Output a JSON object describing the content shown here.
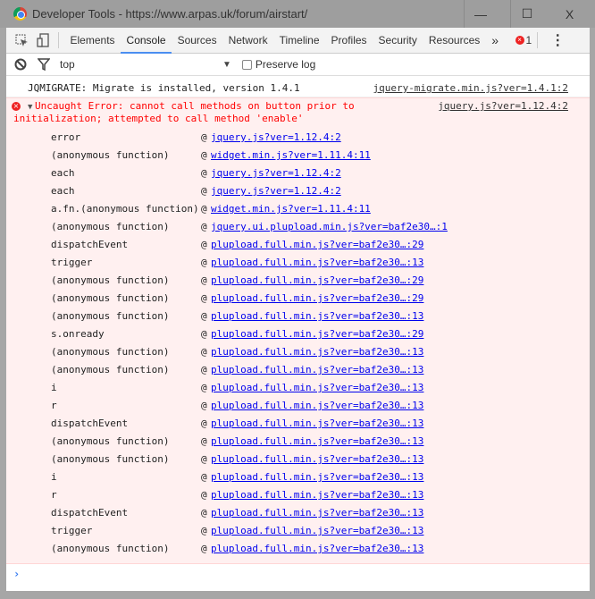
{
  "window": {
    "title": "Developer Tools - https://www.arpas.uk/forum/airstart/",
    "minimize": "—",
    "maximize": "☐",
    "close": "X"
  },
  "tabs": [
    "Elements",
    "Console",
    "Sources",
    "Network",
    "Timeline",
    "Profiles",
    "Security",
    "Resources"
  ],
  "more_tabs": "»",
  "error_count": "1",
  "menu": "⋮",
  "filter": {
    "context": "top",
    "preserve_log": "Preserve log",
    "preserve_checked": false
  },
  "messages": {
    "info": {
      "text": "JQMIGRATE: Migrate is installed, version 1.4.1",
      "source": "jquery-migrate.min.js?ver=1.4.1:2"
    },
    "error": {
      "line1": "Uncaught Error: cannot call methods on button prior to",
      "line2": "initialization; attempted to call method 'enable'",
      "source": "jquery.js?ver=1.12.4:2"
    }
  },
  "stack": [
    {
      "fn": "error",
      "src": "jquery.js?ver=1.12.4:2"
    },
    {
      "fn": "(anonymous function)",
      "src": "widget.min.js?ver=1.11.4:11"
    },
    {
      "fn": "each",
      "src": "jquery.js?ver=1.12.4:2"
    },
    {
      "fn": "each",
      "src": "jquery.js?ver=1.12.4:2"
    },
    {
      "fn": "a.fn.(anonymous function)",
      "src": "widget.min.js?ver=1.11.4:11"
    },
    {
      "fn": "(anonymous function)",
      "src": "jquery.ui.plupload.min.js?ver=baf2e30…:1"
    },
    {
      "fn": "dispatchEvent",
      "src": "plupload.full.min.js?ver=baf2e30…:29"
    },
    {
      "fn": "trigger",
      "src": "plupload.full.min.js?ver=baf2e30…:13"
    },
    {
      "fn": "(anonymous function)",
      "src": "plupload.full.min.js?ver=baf2e30…:29"
    },
    {
      "fn": "(anonymous function)",
      "src": "plupload.full.min.js?ver=baf2e30…:29"
    },
    {
      "fn": "(anonymous function)",
      "src": "plupload.full.min.js?ver=baf2e30…:13"
    },
    {
      "fn": "s.onready",
      "src": "plupload.full.min.js?ver=baf2e30…:29"
    },
    {
      "fn": "(anonymous function)",
      "src": "plupload.full.min.js?ver=baf2e30…:13"
    },
    {
      "fn": "(anonymous function)",
      "src": "plupload.full.min.js?ver=baf2e30…:13"
    },
    {
      "fn": "i",
      "src": "plupload.full.min.js?ver=baf2e30…:13"
    },
    {
      "fn": "r",
      "src": "plupload.full.min.js?ver=baf2e30…:13"
    },
    {
      "fn": "dispatchEvent",
      "src": "plupload.full.min.js?ver=baf2e30…:13"
    },
    {
      "fn": "(anonymous function)",
      "src": "plupload.full.min.js?ver=baf2e30…:13"
    },
    {
      "fn": "(anonymous function)",
      "src": "plupload.full.min.js?ver=baf2e30…:13"
    },
    {
      "fn": "i",
      "src": "plupload.full.min.js?ver=baf2e30…:13"
    },
    {
      "fn": "r",
      "src": "plupload.full.min.js?ver=baf2e30…:13"
    },
    {
      "fn": "dispatchEvent",
      "src": "plupload.full.min.js?ver=baf2e30…:13"
    },
    {
      "fn": "trigger",
      "src": "plupload.full.min.js?ver=baf2e30…:13"
    },
    {
      "fn": "(anonymous function)",
      "src": "plupload.full.min.js?ver=baf2e30…:13"
    }
  ],
  "prompt": "›"
}
